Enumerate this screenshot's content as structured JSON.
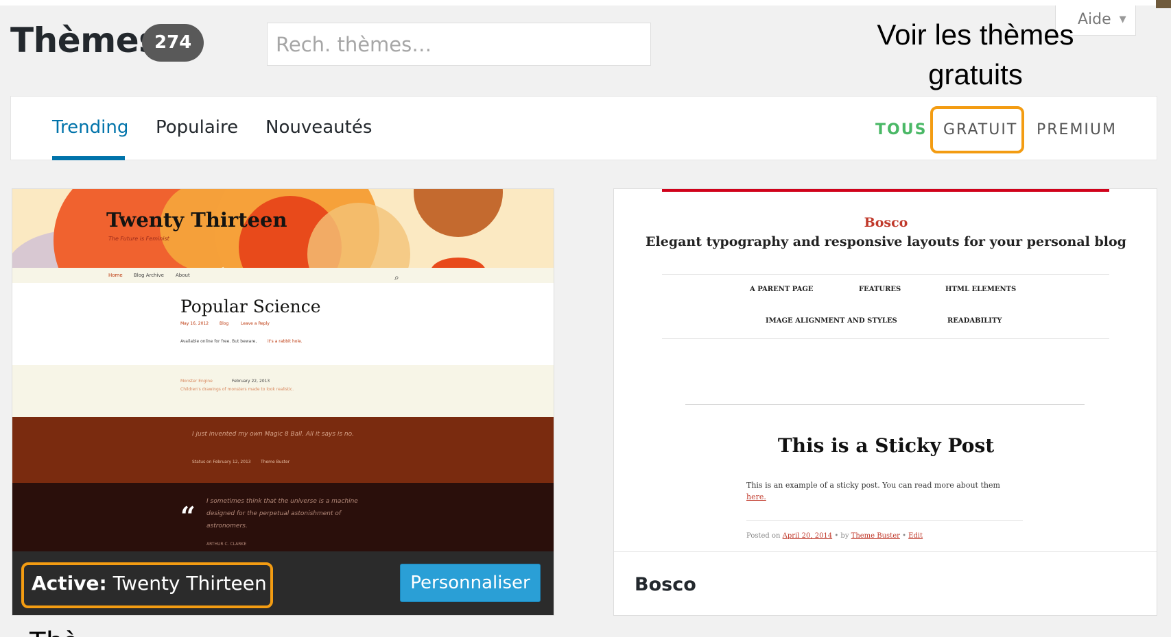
{
  "help": {
    "label": "Aide",
    "caret": "▼"
  },
  "header": {
    "title": "Thèmes",
    "count": "274",
    "search_placeholder": "Rech. thèmes…"
  },
  "annotations": {
    "top_line1": "Voir les thèmes",
    "top_line2": "gratuits",
    "bottom": "Thè"
  },
  "filter": {
    "tabs": [
      {
        "label": "Trending",
        "active": true
      },
      {
        "label": "Populaire",
        "active": false
      },
      {
        "label": "Nouveautés",
        "active": false
      }
    ],
    "types": [
      "TOUS",
      "GRATUIT",
      "PREMIUM"
    ]
  },
  "themes": {
    "active": {
      "preview": {
        "site_title": "Twenty Thirteen",
        "tagline": "The Future is Feminist",
        "nav": [
          "Home",
          "Blog Archive",
          "About"
        ],
        "post_title": "Popular Science",
        "post_meta": [
          "May 16, 2012",
          "Blog",
          "Leave a Reply"
        ],
        "post_excerpt": "Available online for free. But beware,",
        "post_link": "it's a rabbit hole.",
        "aside_author": "Monster Engine",
        "aside_date": "February 22, 2013",
        "aside_text": "Children's drawings of monsters made to look realistic.",
        "status_text": "I just invented my own Magic 8 Ball. All it says is no.",
        "status_meta": [
          "Status on February 12, 2013",
          "Theme Buster"
        ],
        "quote_mark": "“",
        "quote_text_1": "I sometimes think that the universe is a machine",
        "quote_text_2": "designed for the perpetual astonishment of",
        "quote_text_3": "astronomers.",
        "quote_author": "ARTHUR C. CLARKE"
      },
      "label_prefix": "Active:",
      "name": "Twenty Thirteen",
      "customize_label": "Personnaliser"
    },
    "second": {
      "preview": {
        "site_name": "Bosco",
        "tagline": "Elegant typography and responsive layouts for your personal blog",
        "menu_row1": [
          "A PARENT PAGE",
          "FEATURES",
          "HTML ELEMENTS"
        ],
        "menu_row2": [
          "IMAGE ALIGNMENT AND STYLES",
          "READABILITY"
        ],
        "post_title": "This is a Sticky Post",
        "post_text": "This is an example of a sticky post. You can read more about them",
        "post_link": "here.",
        "posted_on": "Posted on",
        "posted_date": "April 20, 2014",
        "posted_by": " • by ",
        "posted_author": "Theme Buster",
        "edit_sep": " • ",
        "edit": "Edit"
      },
      "name": "Bosco"
    }
  },
  "colors": {
    "accent_blue": "#0073aa",
    "tous_green": "#4ab866",
    "annotation_orange": "#f39c12",
    "button_blue": "#2a9fd6"
  }
}
